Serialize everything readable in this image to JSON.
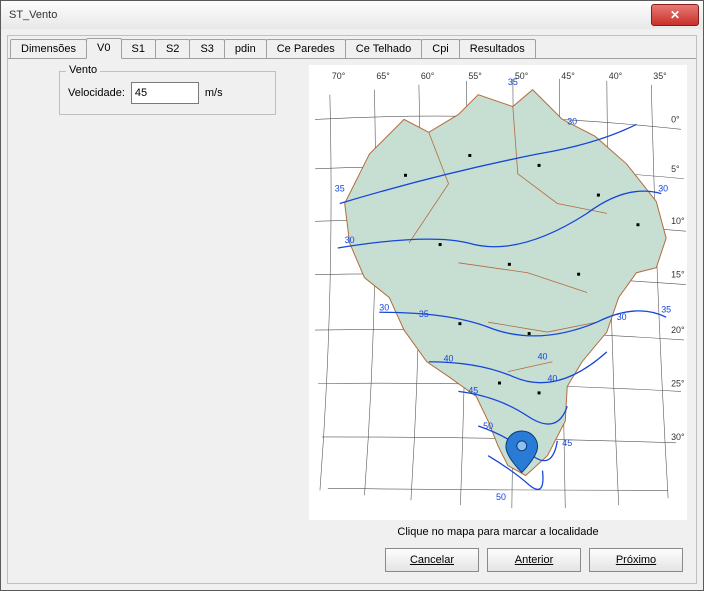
{
  "window": {
    "title": "ST_Vento"
  },
  "tabs": [
    "Dimensões",
    "V0",
    "S1",
    "S2",
    "S3",
    "pdin",
    "Ce Paredes",
    "Ce Telhado",
    "Cpi",
    "Resultados"
  ],
  "active_tab": 1,
  "vento_group": {
    "legend": "Vento",
    "velocidade_label": "Velocidade:",
    "velocidade_value": "45",
    "velocidade_unit": "m/s"
  },
  "map": {
    "hint": "Clique no mapa para marcar a localidade",
    "isoline_labels": [
      "35",
      "30",
      "35",
      "30",
      "30",
      "35",
      "40",
      "45",
      "50",
      "50",
      "45",
      "40",
      "40",
      "30",
      "30",
      "35"
    ],
    "lon_labels": [
      "70°",
      "65°",
      "60°",
      "55°",
      "50°",
      "45°",
      "40°",
      "35°"
    ],
    "lat_labels": [
      "0°",
      "5°",
      "10°",
      "15°",
      "20°",
      "25°",
      "30°"
    ],
    "colors": {
      "land": "#c7ded3",
      "border": "#b36b3a",
      "grid": "#555",
      "iso": "#1546d8"
    }
  },
  "buttons": {
    "cancel": "Cancelar",
    "prev": "Anterior",
    "next": "Próximo"
  }
}
